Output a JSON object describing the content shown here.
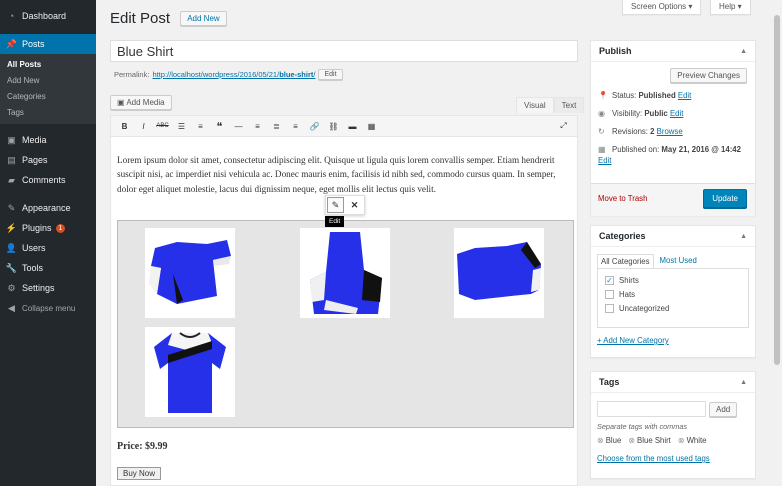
{
  "sidebar": {
    "items": [
      {
        "label": "Dashboard",
        "icon": "dashboard-icon"
      },
      {
        "label": "Posts",
        "icon": "pushpin-icon"
      },
      {
        "label": "Media",
        "icon": "media-icon"
      },
      {
        "label": "Pages",
        "icon": "pages-icon"
      },
      {
        "label": "Comments",
        "icon": "comments-icon"
      },
      {
        "label": "Appearance",
        "icon": "brush-icon"
      },
      {
        "label": "Plugins",
        "icon": "plugin-icon",
        "badge": "1"
      },
      {
        "label": "Users",
        "icon": "users-icon"
      },
      {
        "label": "Tools",
        "icon": "wrench-icon"
      },
      {
        "label": "Settings",
        "icon": "settings-icon"
      },
      {
        "label": "Collapse menu",
        "icon": "collapse-icon"
      }
    ],
    "posts_submenu": [
      "All Posts",
      "Add New",
      "Categories",
      "Tags"
    ]
  },
  "header": {
    "screen_options": "Screen Options ▾",
    "help": "Help ▾",
    "page_title": "Edit Post",
    "add_new": "Add New"
  },
  "post": {
    "title": "Blue Shirt",
    "permalink_label": "Permalink:",
    "permalink_base": "http://localhost/wordpress/2016/05/21/",
    "permalink_slug": "blue-shirt",
    "permalink_end": "/",
    "permalink_edit": "Edit"
  },
  "editor": {
    "add_media": "Add Media",
    "tab_visual": "Visual",
    "tab_text": "Text",
    "body_text": "Lorem ipsum dolor sit amet, consectetur adipiscing elit. Quisque ut ligula quis lorem convallis semper. Etiam hendrerit suscipit nisi, ac imperdiet nisi vehicula ac. Donec mauris enim, facilisis id nibh sed, commodo cursus quam. In semper, dolor eget aliquet molestie, lacus dui dignissim neque, eget mollis elit lectus quis velit.",
    "tooltip": "Edit",
    "price": "Price: $9.99",
    "buy_now": "Buy Now"
  },
  "publish": {
    "heading": "Publish",
    "preview": "Preview Changes",
    "status_label": "Status:",
    "status_value": "Published",
    "visibility_label": "Visibility:",
    "visibility_value": "Public",
    "revisions_label": "Revisions:",
    "revisions_value": "2",
    "browse": "Browse",
    "published_label": "Published on:",
    "published_value": "May 21, 2016 @ 14:42",
    "edit": "Edit",
    "trash": "Move to Trash",
    "update": "Update"
  },
  "categories": {
    "heading": "Categories",
    "tab_all": "All Categories",
    "tab_used": "Most Used",
    "items": [
      {
        "label": "Shirts",
        "checked": "✓"
      },
      {
        "label": "Hats",
        "checked": ""
      },
      {
        "label": "Uncategorized",
        "checked": ""
      }
    ],
    "add_new": "+ Add New Category"
  },
  "tags": {
    "heading": "Tags",
    "add": "Add",
    "hint": "Separate tags with commas",
    "items": [
      "Blue",
      "Blue Shirt",
      "White"
    ],
    "choose": "Choose from the most used tags"
  },
  "colors": {
    "sidebar_bg": "#23282d",
    "accent": "#0073aa",
    "shirt_blue": "#2530e8"
  }
}
